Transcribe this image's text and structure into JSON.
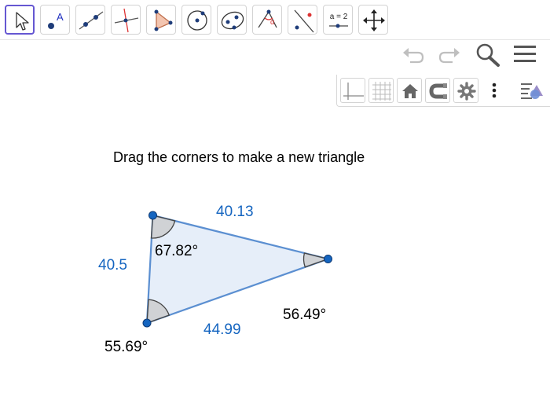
{
  "toolbar": {
    "tools": [
      {
        "icon": "move-arrow-icon"
      },
      {
        "icon": "point-icon",
        "glyph": "A"
      },
      {
        "icon": "line-icon"
      },
      {
        "icon": "perpendicular-line-icon"
      },
      {
        "icon": "polygon-icon"
      },
      {
        "icon": "circle-center-point-icon"
      },
      {
        "icon": "ellipse-icon"
      },
      {
        "icon": "angle-icon",
        "glyph": "α"
      },
      {
        "icon": "reflect-about-line-icon"
      },
      {
        "icon": "slider-icon",
        "glyph": "a = 2"
      },
      {
        "icon": "move-graphics-view-icon"
      }
    ]
  },
  "top_actions": [
    "undo-icon",
    "redo-icon",
    "search-icon",
    "menu-icon"
  ],
  "style_bar": [
    "axes-icon",
    "grid-icon",
    "home-icon",
    "magnet-icon",
    "settings-icon",
    "more-vertical-icon",
    "toggle-style-bar-icon"
  ],
  "instruction": "Drag the corners to make a new triangle",
  "triangle": {
    "sides": {
      "top": "40.13",
      "left": "40.5",
      "bottom": "44.99"
    },
    "angles": {
      "top_left": "67.82°",
      "right": "56.49°",
      "bottom_left": "55.69°"
    }
  },
  "colors": {
    "accent": "#6557d2",
    "triangle_stroke": "#5b8fd1",
    "triangle_fill": "#e6eef9",
    "point": "#1565c0",
    "side_label": "#1565c0",
    "angle_fill": "#c8c8c8"
  }
}
